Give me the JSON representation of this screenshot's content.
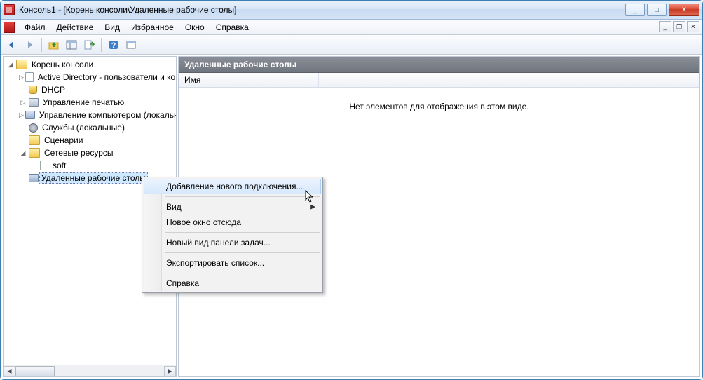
{
  "window": {
    "title": "Консоль1 - [Корень консоли\\Удаленные рабочие столы]"
  },
  "menu": {
    "file": "Файл",
    "action": "Действие",
    "view": "Вид",
    "favorites": "Избранное",
    "window": "Окно",
    "help": "Справка"
  },
  "tree": {
    "root": "Корень консоли",
    "ad": "Active Directory - пользователи и компьютеры",
    "dhcp": "DHCP",
    "print": "Управление печатью",
    "computer": "Управление компьютером (локальный)",
    "services": "Службы (локальные)",
    "scenarios": "Сценарии",
    "network": "Сетевые ресурсы",
    "soft": "soft",
    "rdp": "Удаленные рабочие столы"
  },
  "content": {
    "header": "Удаленные рабочие столы",
    "column_name": "Имя",
    "empty_message": "Нет элементов для отображения в этом виде."
  },
  "context_menu": {
    "add_connection": "Добавление нового подключения...",
    "view": "Вид",
    "new_window": "Новое окно отсюда",
    "new_taskpad": "Новый вид панели задач...",
    "export_list": "Экспортировать список...",
    "help": "Справка"
  },
  "window_controls": {
    "minimize": "_",
    "maximize": "□",
    "close": "✕"
  }
}
